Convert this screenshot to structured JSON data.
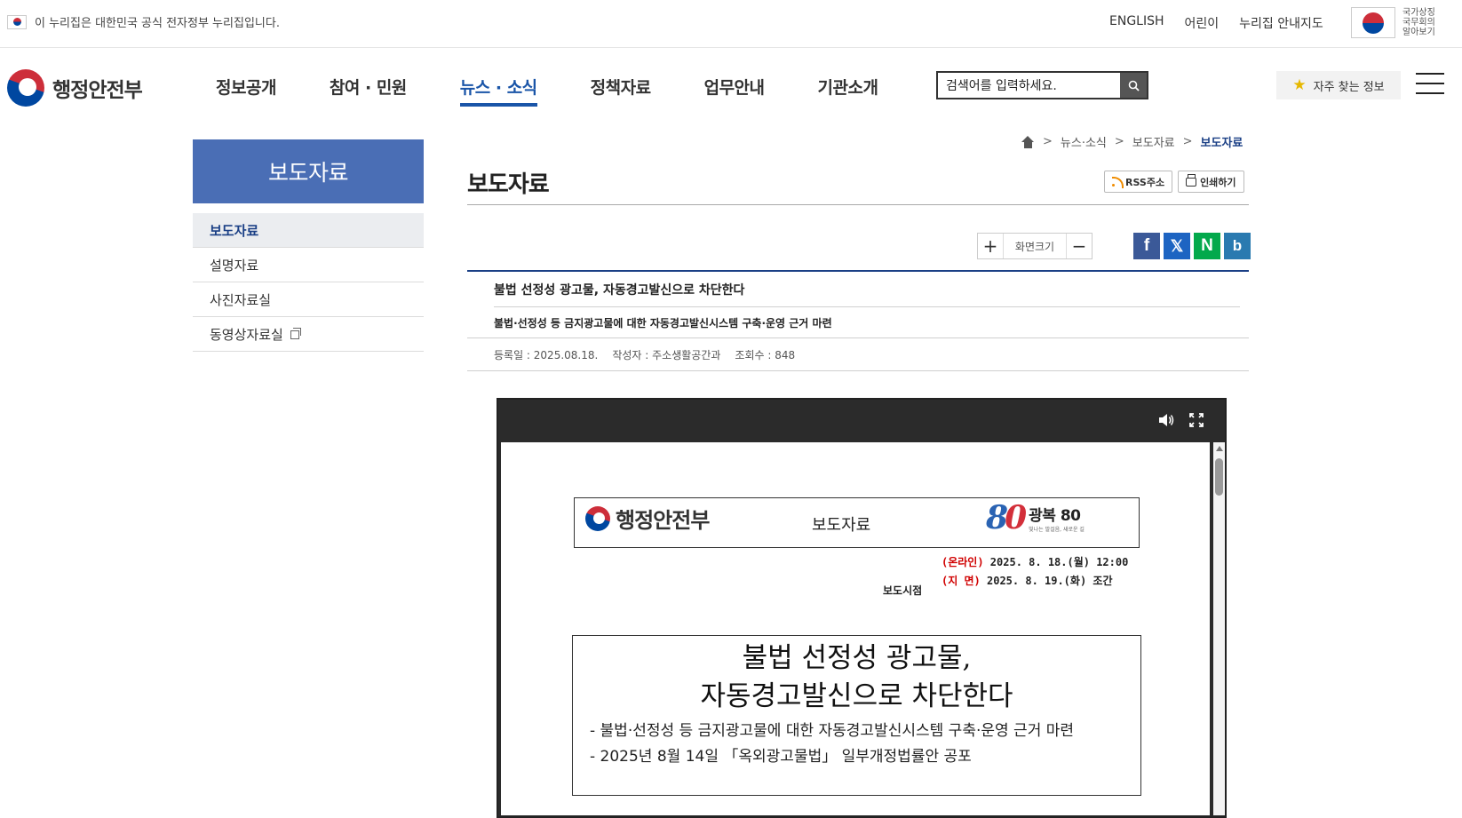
{
  "topbar": {
    "gov_notice": "이 누리집은 대한민국 공식 전자정부 누리집입니다.",
    "links": [
      "ENGLISH",
      "어린이",
      "누리집 안내지도"
    ],
    "national_symbol_label": "국가상징 국무회의 알아보기"
  },
  "header": {
    "logo_text": "행정안전부",
    "nav": [
      "정보공개",
      "참여 · 민원",
      "뉴스 · 소식",
      "정책자료",
      "업무안내",
      "기관소개"
    ],
    "active_nav": "뉴스 · 소식",
    "search_placeholder": "검색어를 입력하세요.",
    "favorites_label": "자주 찾는 정보",
    "accent_color": "#1a55a8"
  },
  "lnb": {
    "title": "보도자료",
    "items": [
      "보도자료",
      "설명자료",
      "사진자료실",
      "동영상자료실"
    ],
    "active_item": "보도자료"
  },
  "breadcrumb": [
    "뉴스·소식",
    "보도자료",
    "보도자료"
  ],
  "page": {
    "title": "보도자료",
    "rss_label": "RSS주소",
    "print_label": "인쇄하기",
    "zoom_label": "화면크기",
    "zoom_in": "+",
    "zoom_out": "−",
    "share": [
      {
        "name": "facebook",
        "glyph": "f"
      },
      {
        "name": "x",
        "glyph": "𝕏"
      },
      {
        "name": "naver",
        "glyph": "N"
      },
      {
        "name": "band",
        "glyph": "b"
      }
    ]
  },
  "article": {
    "title": "불법 선정성 광고물, 자동경고발신으로 차단한다",
    "subtitle": "불법·선정성 등 금지광고물에 대한 자동경고발신시스템 구축·운영 근거 마련",
    "meta": {
      "date": "등록일 : 2025.08.18.",
      "author": "작성자 : 주소생활공간과",
      "views": "조회수 : 848"
    }
  },
  "document": {
    "logo_text": "행정안전부",
    "doc_type": "보도자료",
    "emblem": {
      "num_main": "8",
      "num_accent": "0",
      "title": "광복 80",
      "sub": "빛나는 발걸음, 새로운 길"
    },
    "release_label": "보도시점",
    "release": {
      "online_tag": "(온라인)",
      "online_time": " 2025. 8. 18.(월) 12:00",
      "print_tag": "(지  면)",
      "print_time": " 2025. 8. 19.(화) 조간"
    },
    "title_line1": "불법 선정성 광고물,",
    "title_line2": "자동경고발신으로 차단한다",
    "bullet1": "- 불법·선정성 등 금지광고물에 대한 자동경고발신시스템 구축·운영 근거 마련",
    "bullet2": "- 2025년 8월 14일 「옥외광고물법」 일부개정법률안 공포"
  }
}
